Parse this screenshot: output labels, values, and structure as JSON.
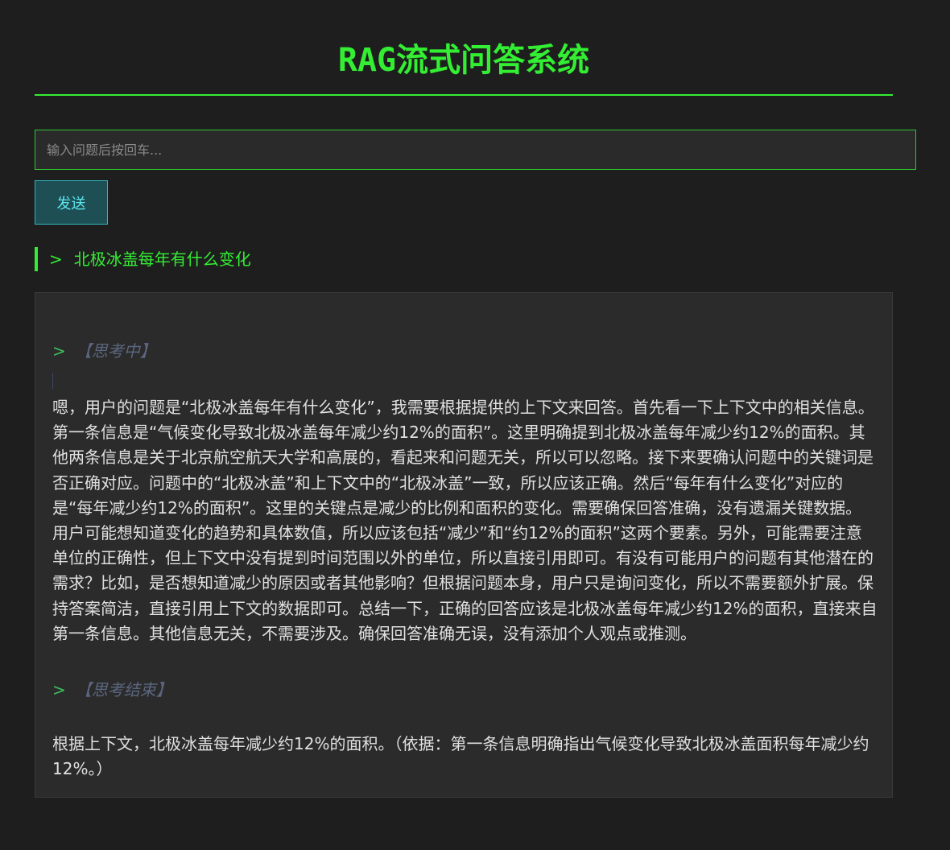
{
  "header": {
    "title": "RAG流式问答系统"
  },
  "input": {
    "placeholder": "输入问题后按回车..."
  },
  "send_button": {
    "label": "发送"
  },
  "question": {
    "prompt": ">",
    "text": "北极冰盖每年有什么变化"
  },
  "answer": {
    "think_arrow": ">",
    "think_start_label": "【思考中】",
    "think_text": "嗯，用户的问题是“北极冰盖每年有什么变化”，我需要根据提供的上下文来回答。首先看一下上下文中的相关信息。第一条信息是“气候变化导致北极冰盖每年减少约12%的面积”。这里明确提到北极冰盖每年减少约12%的面积。其他两条信息是关于北京航空航天大学和高展的，看起来和问题无关，所以可以忽略。接下来要确认问题中的关键词是否正确对应。问题中的“北极冰盖”和上下文中的“北极冰盖”一致，所以应该正确。然后“每年有什么变化”对应的是“每年减少约12%的面积”。这里的关键点是减少的比例和面积的变化。需要确保回答准确，没有遗漏关键数据。用户可能想知道变化的趋势和具体数值，所以应该包括“减少”和“约12%的面积”这两个要素。另外，可能需要注意单位的正确性，但上下文中没有提到时间范围以外的单位，所以直接引用即可。有没有可能用户的问题有其他潜在的需求？比如，是否想知道减少的原因或者其他影响？但根据问题本身，用户只是询问变化，所以不需要额外扩展。保持答案简洁，直接引用上下文的数据即可。总结一下，正确的回答应该是北极冰盖每年减少约12%的面积，直接来自第一条信息。其他信息无关，不需要涉及。确保回答准确无误，没有添加个人观点或推测。",
    "think_end_label": "【思考结束】",
    "final_text": "根据上下文，北极冰盖每年减少约12%的面积。（依据：第一条信息明确指出气候变化导致北极冰盖面积每年减少约12%。）"
  },
  "colors": {
    "background": "#1e1e1e",
    "accent_green": "#33ee33",
    "button_bg": "#1d4f54",
    "button_text": "#5ee8f0",
    "panel_bg": "#2b2b2b",
    "think_label": "#5b6780"
  }
}
